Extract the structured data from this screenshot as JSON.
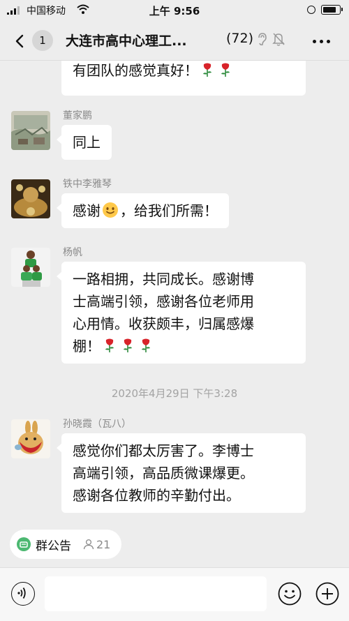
{
  "status_bar": {
    "carrier": "中国移动",
    "time": "上午 9:56",
    "battery_level": 0.8
  },
  "nav": {
    "back_count": "1",
    "title": "大连市高中心理工...",
    "member_count": "(72)"
  },
  "messages": [
    {
      "partial": true,
      "text": "有团队的感觉真好！",
      "icons": [
        "rose",
        "rose"
      ]
    },
    {
      "sender": "董家鹏",
      "avatar": "painting-avatar",
      "text": "同上"
    },
    {
      "sender": "铁中李雅琴",
      "avatar": "buddha-avatar",
      "text_before": "感谢",
      "emoji": "smile",
      "text_after": "，给我们所需！"
    },
    {
      "sender": "杨帆",
      "avatar": "kids-avatar",
      "lines": [
        "一路相拥，共同成长。感谢博",
        "士高端引领，感谢各位老师用",
        "心用情。收获颇丰，归属感爆",
        "棚！"
      ],
      "icons": [
        "rose",
        "rose",
        "rose"
      ]
    },
    {
      "time_divider": "2020年4月29日 下午3:28"
    },
    {
      "sender": "孙晓霞（瓦八）",
      "avatar": "rabbit-avatar",
      "lines": [
        "感觉你们都太厉害了。李博士",
        "高端引领，高品质微课爆更。",
        "感谢各位教师的辛勤付出。"
      ]
    }
  ],
  "notice": {
    "label": "群公告",
    "count": "21"
  },
  "colors": {
    "background": "#ededed",
    "bubble": "#ffffff",
    "notice_green": "#4cb871",
    "rose_red": "#d8232a",
    "leaf_green": "#2e8b3d"
  }
}
